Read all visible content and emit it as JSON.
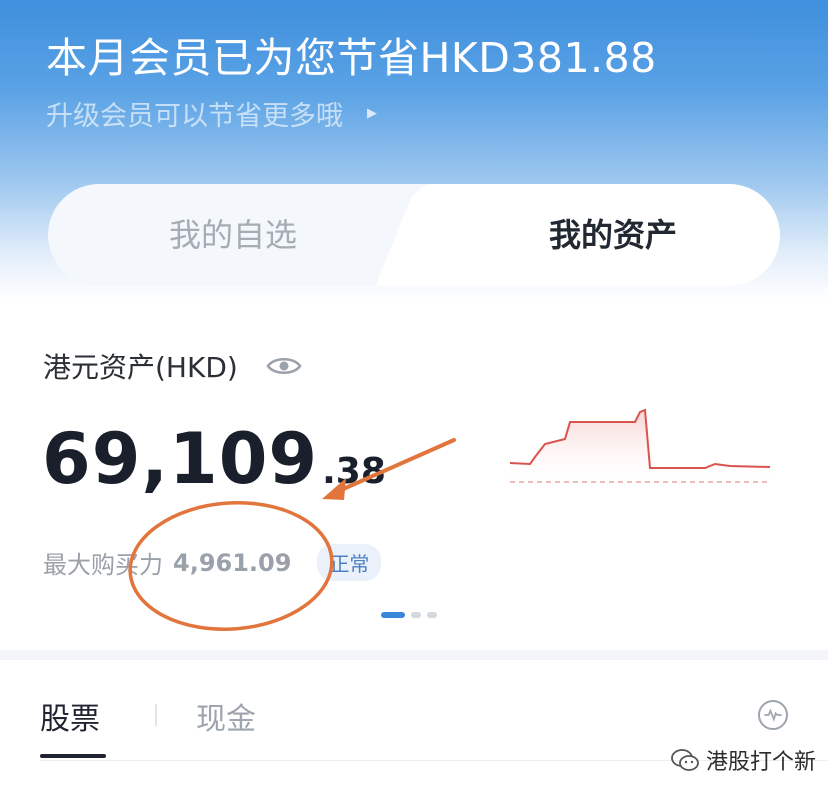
{
  "banner": {
    "title": "本月会员已为您节省HKD381.88",
    "subtitle": "升级会员可以节省更多哦",
    "chevron": "›"
  },
  "tabs": [
    {
      "label": "我的自选",
      "active": false
    },
    {
      "label": "我的资产",
      "active": true
    }
  ],
  "assets": {
    "label": "港元资产(HKD)",
    "value_int": "69,109",
    "value_dec": ".38",
    "buying_power_label": "最大购买力",
    "buying_power_value": "4,961.09",
    "status_badge": "正常"
  },
  "carousel": {
    "pages": 3,
    "current": 0
  },
  "bottom_tabs": {
    "stocks": "股票",
    "cash": "现金",
    "active": "stocks"
  },
  "watermark": {
    "text": "港股打个新"
  },
  "colors": {
    "brand_blue": "#3a86d9",
    "chart_line": "#d9534f",
    "annotation": "#e2753c"
  },
  "icons": {
    "eye": "eye-icon",
    "pulse": "pulse-icon",
    "wechat": "wechat-icon"
  }
}
